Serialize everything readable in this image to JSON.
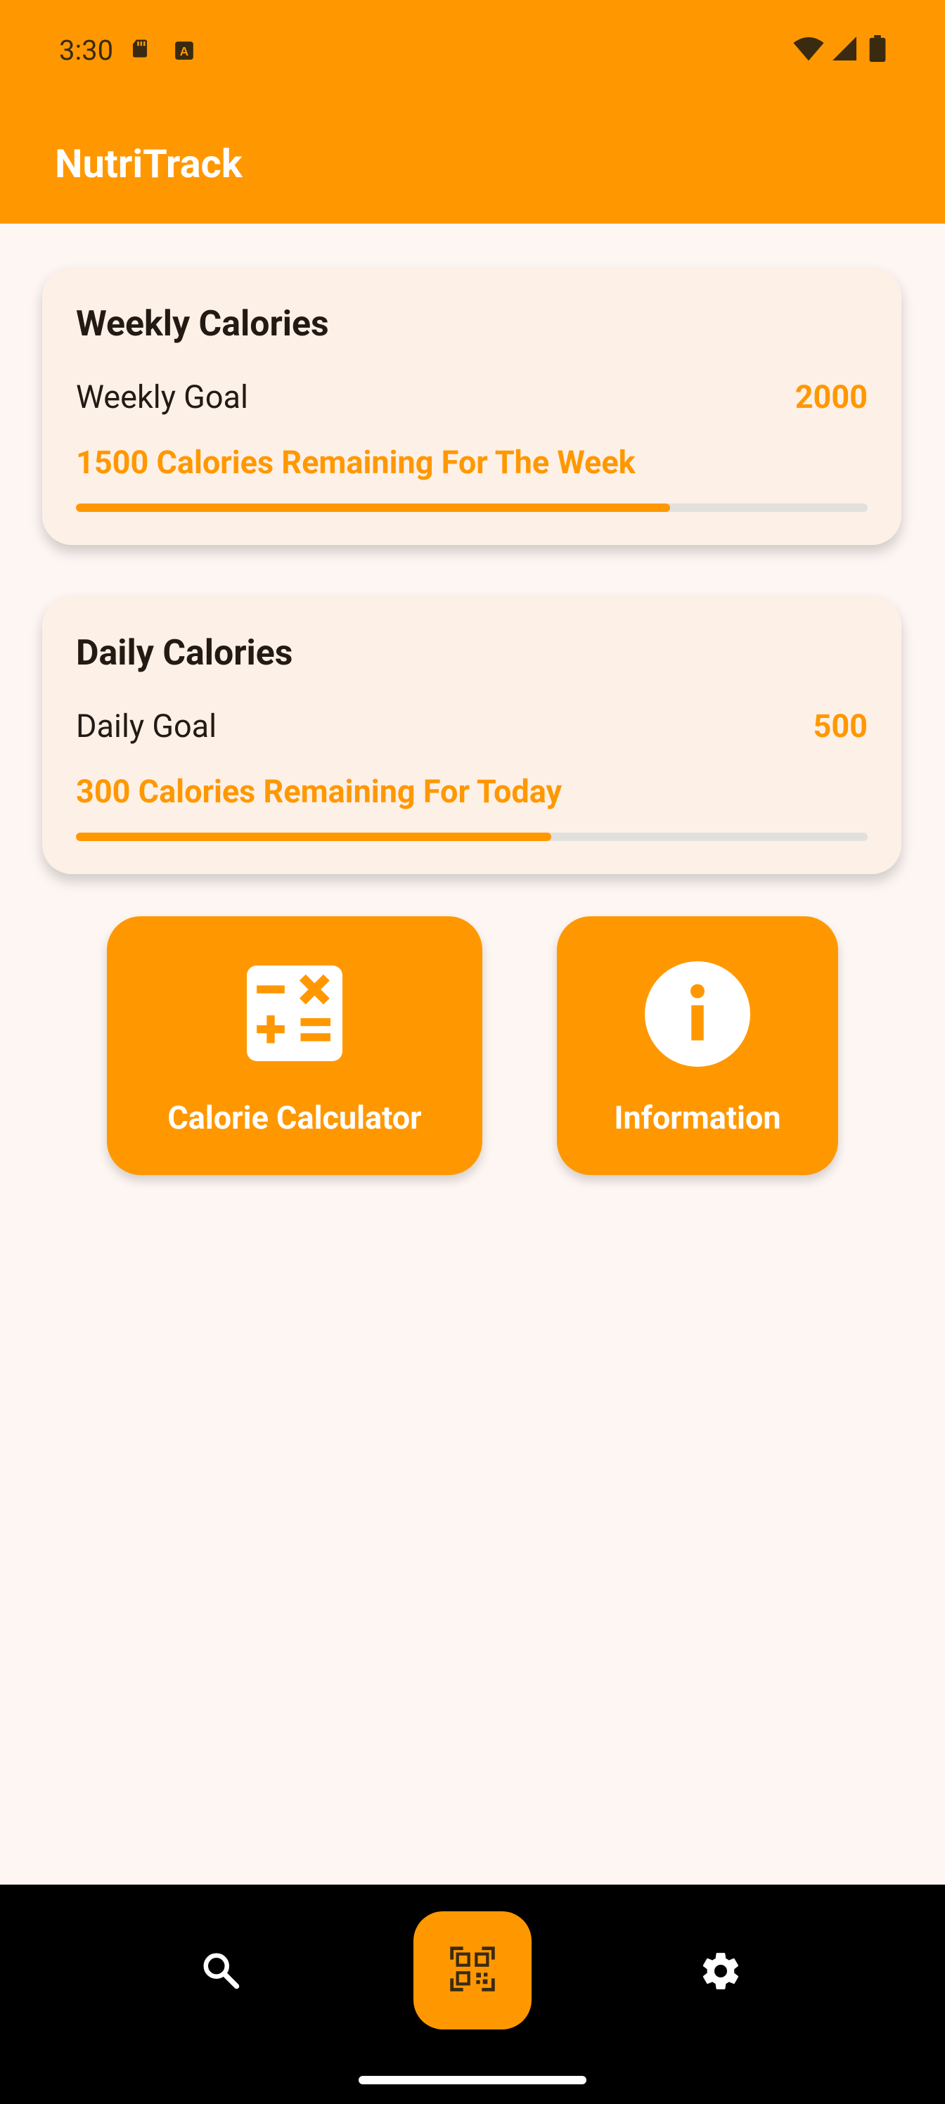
{
  "status_bar": {
    "time": "3:30",
    "icons": [
      "sd-card-icon",
      "keyboard-a-icon",
      "wifi-icon",
      "signal-icon",
      "battery-icon"
    ]
  },
  "app": {
    "title": "NutriTrack",
    "accent_color": "#ff9800"
  },
  "weekly": {
    "title": "Weekly Calories",
    "goal_label": "Weekly Goal",
    "goal_value": "2000",
    "remaining_text": "1500 Calories Remaining For The Week",
    "progress_fraction": 0.75
  },
  "daily": {
    "title": "Daily Calories",
    "goal_label": "Daily Goal",
    "goal_value": "500",
    "remaining_text": "300 Calories Remaining For Today",
    "progress_fraction": 0.6
  },
  "actions": {
    "calculator_label": "Calorie Calculator",
    "information_label": "Information"
  },
  "bottom_nav": {
    "items": [
      "search-icon",
      "qr-scan-icon",
      "settings-icon"
    ]
  }
}
